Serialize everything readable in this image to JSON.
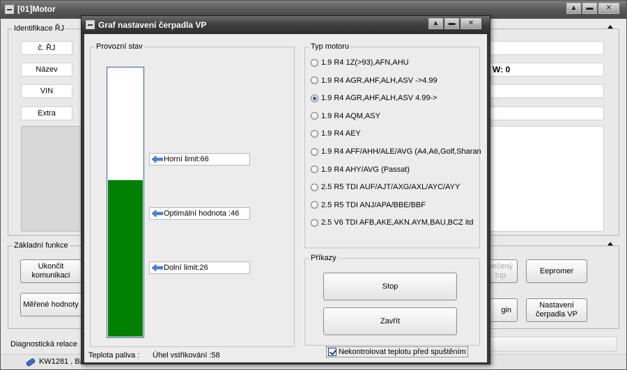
{
  "main_window": {
    "title": "[01]Motor",
    "controls": {
      "minimize": "▲",
      "restore": "▬",
      "close": "✕"
    },
    "identification": {
      "legend": "Identifikace ŘJ",
      "labels": [
        "č. ŘJ",
        "Název",
        "VIN",
        "Extra"
      ],
      "w_value": "W: 0"
    },
    "basic_functions": {
      "legend": "Základní funkce",
      "buttons": {
        "end_comm": "Ukončit\nkomunikaci",
        "measured": "Měřené hodnoty",
        "secured_partial": "pečený\ntup",
        "eeprom": "Eepromer",
        "login_partial": "gin",
        "pump_settings": "Nastavení\nčerpadla VP"
      }
    },
    "diag_session": "Diagnostická relace",
    "status_text": "KW1281 , Bau"
  },
  "dialog": {
    "title": "Graf nastavení čerpadla VP",
    "controls": {
      "minimize": "▲",
      "restore": "▬",
      "close": "✕"
    },
    "operating_state": {
      "legend": "Provozní stav",
      "gauge_value": 58,
      "gauge_max": 100,
      "fill_color": "#008000",
      "upper_limit": "Horní limit:66",
      "optimal": "Optimální hodnota :46",
      "lower_limit": "Dolní limit:26"
    },
    "engine_type": {
      "legend": "Typ motoru",
      "selected_index": 2,
      "options": [
        "1.9 R4 1Z(>93),AFN,AHU",
        "1.9 R4 AGR,AHF,ALH,ASV ->4.99",
        "1.9 R4 AGR,AHF,ALH,ASV 4.99->",
        "1.9 R4 AQM,ASY",
        "1.9 R4 AEY",
        "1.9 R4 AFF/AHH/ALE/AVG (A4,A6,Golf,Sharan",
        "1.9 R4 AHY/AVG (Passat)",
        "2.5 R5 TDI AUF/AJT/AXG/AXL/AYC/AYY",
        "2.5 R5 TDI ANJ/APA/BBE/BBF",
        "2.5 V6 TDI AFB,AKE,AKN.AYM,BAU,BCZ itd"
      ]
    },
    "commands": {
      "legend": "Příkazy",
      "stop": "Stop",
      "close": "Zavřít",
      "skip_temp_check": "Nekontrolovat teplotu před spuštěním",
      "skip_temp_checked": true
    },
    "status": {
      "fuel_temp": "Teplota paliva :",
      "injection_angle": "Úhel vstřikování :58"
    }
  }
}
